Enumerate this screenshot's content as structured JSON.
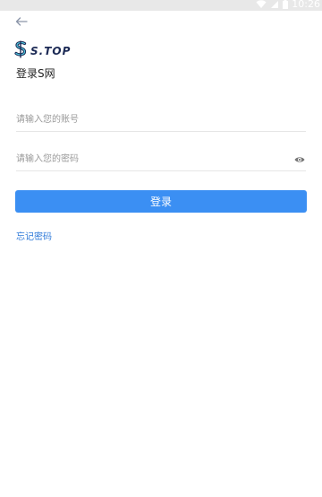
{
  "status_bar": {
    "time": "10:26"
  },
  "header": {
    "back_icon": "arrow-left-icon"
  },
  "brand": {
    "logo_text": "S.TOP",
    "colors": {
      "logo_primary": "#1c2a55",
      "logo_accent": "#4cc3d9"
    }
  },
  "form": {
    "subtitle": "登录S网",
    "account": {
      "value": "",
      "placeholder": "请输入您的账号"
    },
    "password": {
      "value": "",
      "placeholder": "请输入您的密码",
      "toggle_icon": "eye-icon"
    },
    "submit_label": "登录",
    "forgot_label": "忘记密码"
  },
  "colors": {
    "accent": "#3b8ff3",
    "link": "#2f7ad9",
    "status_bar_bg": "#e8e8e8"
  }
}
